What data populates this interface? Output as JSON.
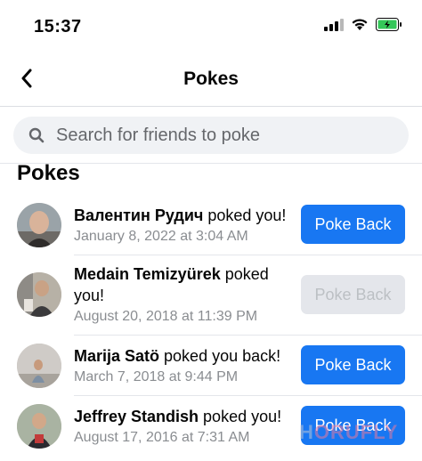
{
  "status_bar": {
    "time": "15:37"
  },
  "nav": {
    "title": "Pokes"
  },
  "search": {
    "placeholder": "Search for friends to poke"
  },
  "section": {
    "heading": "Pokes"
  },
  "pokes": [
    {
      "name": "Валентин Рудич",
      "action": " poked you!",
      "date": "January 8, 2022 at 3:04 AM",
      "button": "Poke Back",
      "button_enabled": true
    },
    {
      "name": "Medain Temizyürek",
      "action": " poked you!",
      "date": "August 20, 2018 at 11:39 PM",
      "button": "Poke Back",
      "button_enabled": false
    },
    {
      "name": "Marija Satö",
      "action": " poked you back!",
      "date": "March 7, 2018 at 9:44 PM",
      "button": "Poke Back",
      "button_enabled": true
    },
    {
      "name": "Jeffrey Standish",
      "action": " poked you!",
      "date": "August 17, 2016 at 7:31 AM",
      "button": "Poke Back",
      "button_enabled": true
    }
  ],
  "watermark": {
    "part1": "H",
    "part2": "ORUFLY"
  },
  "colors": {
    "accent": "#1877f2",
    "disabled_bg": "#e4e6eb",
    "battery": "#34c759"
  }
}
